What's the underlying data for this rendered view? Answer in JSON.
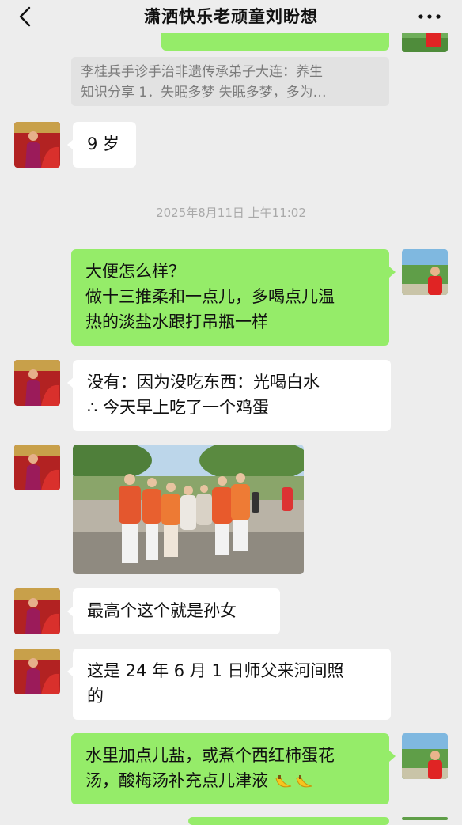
{
  "header": {
    "title": "潇洒快乐老顽童刘盼想",
    "back_icon": "chevron-left-icon",
    "more_icon": "more-dots-icon"
  },
  "quote": {
    "line1": "李桂兵手诊手治非遗传承弟子大连：养生",
    "line2": "知识分享 1．失眠多梦 失眠多梦，多为…"
  },
  "timestamp": "2025年8月11日 上午11:02",
  "messages": [
    {
      "side": "in",
      "lines": [
        "9 岁"
      ]
    },
    {
      "side": "out",
      "lines": [
        "大便怎么样？",
        "做十三推柔和一点儿，多喝点儿温",
        "热的淡盐水跟打吊瓶一样"
      ]
    },
    {
      "side": "in",
      "lines": [
        "没有：因为没吃东西：光喝白水",
        "∴ 今天早上吃了一个鸡蛋"
      ]
    },
    {
      "side": "in",
      "type": "image",
      "content": "group-photo"
    },
    {
      "side": "in",
      "lines": [
        "最高个这个就是孙女"
      ]
    },
    {
      "side": "in",
      "lines": [
        "这是 24 年 6 月 1 日师父来河间照",
        "的"
      ]
    },
    {
      "side": "out",
      "lines": [
        "水里加点儿盐，或煮个西红柿蛋花",
        "汤，酸梅汤补充点儿津液"
      ],
      "trailing_icons": [
        "banana-emoji-icon",
        "banana-emoji-icon"
      ]
    }
  ],
  "colors": {
    "background": "#ededed",
    "outgoing_bubble": "#95ec69",
    "incoming_bubble": "#ffffff",
    "quote_bg": "#e2e2e2",
    "muted_text": "#a9a9a9"
  }
}
